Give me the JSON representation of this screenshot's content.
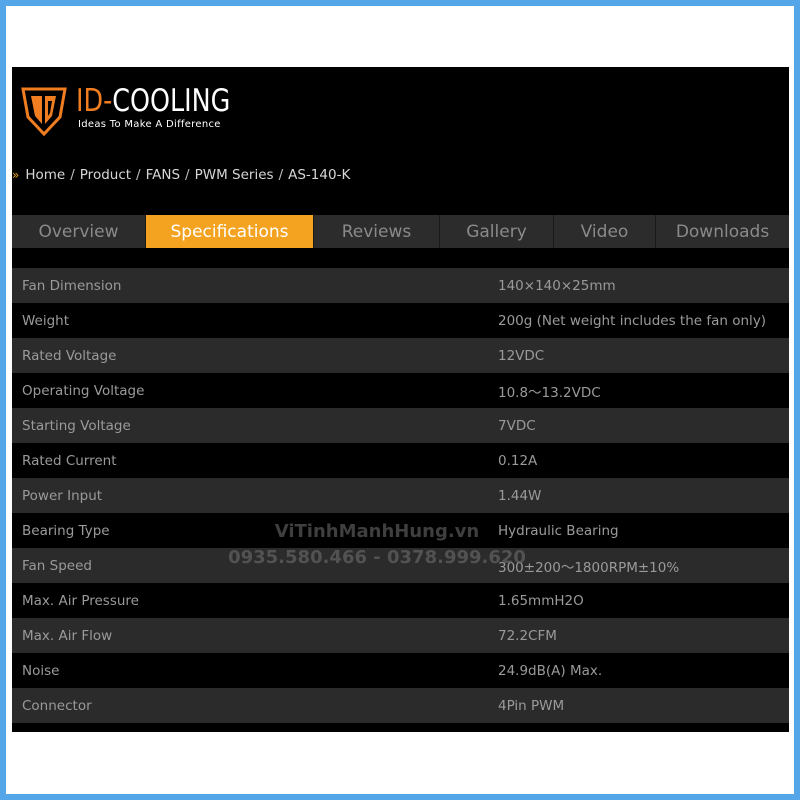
{
  "brand": {
    "name_part1": "ID-",
    "name_part2": "COOLING",
    "tagline": "Ideas To Make A Difference",
    "accent_color": "#f07d20"
  },
  "breadcrumb": {
    "marker": "»",
    "items": [
      "Home",
      "Product",
      "FANS",
      "PWM Series",
      "AS-140-K"
    ],
    "separator": "/"
  },
  "tabs": [
    {
      "label": "Overview",
      "active": false
    },
    {
      "label": "Specifications",
      "active": true
    },
    {
      "label": "Reviews",
      "active": false
    },
    {
      "label": "Gallery",
      "active": false
    },
    {
      "label": "Video",
      "active": false
    },
    {
      "label": "Downloads",
      "active": false
    }
  ],
  "active_tab_color": "#f4a321",
  "specs": [
    {
      "label": "Fan Dimension",
      "value": "140×140×25mm"
    },
    {
      "label": "Weight",
      "value": "200g (Net weight includes the fan only)"
    },
    {
      "label": "Rated Voltage",
      "value": "12VDC"
    },
    {
      "label": "Operating Voltage",
      "value": "10.8～13.2VDC"
    },
    {
      "label": "Starting Voltage",
      "value": "7VDC"
    },
    {
      "label": "Rated Current",
      "value": "0.12A"
    },
    {
      "label": "Power Input",
      "value": "1.44W"
    },
    {
      "label": "Bearing Type",
      "value": "Hydraulic Bearing"
    },
    {
      "label": "Fan Speed",
      "value": "300±200～1800RPM±10%"
    },
    {
      "label": "Max. Air Pressure",
      "value": "1.65mmH2O"
    },
    {
      "label": "Max. Air Flow",
      "value": "72.2CFM"
    },
    {
      "label": "Noise",
      "value": "24.9dB(A) Max."
    },
    {
      "label": "Connector",
      "value": "4Pin PWM"
    }
  ],
  "watermark": {
    "line1": "ViTinhManhHung.vn",
    "line2": "0935.580.466 - 0378.999.620"
  }
}
